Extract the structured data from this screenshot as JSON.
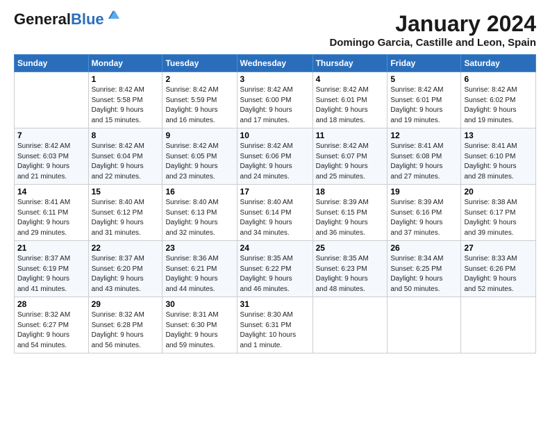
{
  "logo": {
    "general": "General",
    "blue": "Blue"
  },
  "title": "January 2024",
  "subtitle": "Domingo Garcia, Castille and Leon, Spain",
  "headers": [
    "Sunday",
    "Monday",
    "Tuesday",
    "Wednesday",
    "Thursday",
    "Friday",
    "Saturday"
  ],
  "weeks": [
    [
      {
        "day": "",
        "info": ""
      },
      {
        "day": "1",
        "info": "Sunrise: 8:42 AM\nSunset: 5:58 PM\nDaylight: 9 hours\nand 15 minutes."
      },
      {
        "day": "2",
        "info": "Sunrise: 8:42 AM\nSunset: 5:59 PM\nDaylight: 9 hours\nand 16 minutes."
      },
      {
        "day": "3",
        "info": "Sunrise: 8:42 AM\nSunset: 6:00 PM\nDaylight: 9 hours\nand 17 minutes."
      },
      {
        "day": "4",
        "info": "Sunrise: 8:42 AM\nSunset: 6:01 PM\nDaylight: 9 hours\nand 18 minutes."
      },
      {
        "day": "5",
        "info": "Sunrise: 8:42 AM\nSunset: 6:01 PM\nDaylight: 9 hours\nand 19 minutes."
      },
      {
        "day": "6",
        "info": "Sunrise: 8:42 AM\nSunset: 6:02 PM\nDaylight: 9 hours\nand 19 minutes."
      }
    ],
    [
      {
        "day": "7",
        "info": "Sunrise: 8:42 AM\nSunset: 6:03 PM\nDaylight: 9 hours\nand 21 minutes."
      },
      {
        "day": "8",
        "info": "Sunrise: 8:42 AM\nSunset: 6:04 PM\nDaylight: 9 hours\nand 22 minutes."
      },
      {
        "day": "9",
        "info": "Sunrise: 8:42 AM\nSunset: 6:05 PM\nDaylight: 9 hours\nand 23 minutes."
      },
      {
        "day": "10",
        "info": "Sunrise: 8:42 AM\nSunset: 6:06 PM\nDaylight: 9 hours\nand 24 minutes."
      },
      {
        "day": "11",
        "info": "Sunrise: 8:42 AM\nSunset: 6:07 PM\nDaylight: 9 hours\nand 25 minutes."
      },
      {
        "day": "12",
        "info": "Sunrise: 8:41 AM\nSunset: 6:08 PM\nDaylight: 9 hours\nand 27 minutes."
      },
      {
        "day": "13",
        "info": "Sunrise: 8:41 AM\nSunset: 6:10 PM\nDaylight: 9 hours\nand 28 minutes."
      }
    ],
    [
      {
        "day": "14",
        "info": "Sunrise: 8:41 AM\nSunset: 6:11 PM\nDaylight: 9 hours\nand 29 minutes."
      },
      {
        "day": "15",
        "info": "Sunrise: 8:40 AM\nSunset: 6:12 PM\nDaylight: 9 hours\nand 31 minutes."
      },
      {
        "day": "16",
        "info": "Sunrise: 8:40 AM\nSunset: 6:13 PM\nDaylight: 9 hours\nand 32 minutes."
      },
      {
        "day": "17",
        "info": "Sunrise: 8:40 AM\nSunset: 6:14 PM\nDaylight: 9 hours\nand 34 minutes."
      },
      {
        "day": "18",
        "info": "Sunrise: 8:39 AM\nSunset: 6:15 PM\nDaylight: 9 hours\nand 36 minutes."
      },
      {
        "day": "19",
        "info": "Sunrise: 8:39 AM\nSunset: 6:16 PM\nDaylight: 9 hours\nand 37 minutes."
      },
      {
        "day": "20",
        "info": "Sunrise: 8:38 AM\nSunset: 6:17 PM\nDaylight: 9 hours\nand 39 minutes."
      }
    ],
    [
      {
        "day": "21",
        "info": "Sunrise: 8:37 AM\nSunset: 6:19 PM\nDaylight: 9 hours\nand 41 minutes."
      },
      {
        "day": "22",
        "info": "Sunrise: 8:37 AM\nSunset: 6:20 PM\nDaylight: 9 hours\nand 43 minutes."
      },
      {
        "day": "23",
        "info": "Sunrise: 8:36 AM\nSunset: 6:21 PM\nDaylight: 9 hours\nand 44 minutes."
      },
      {
        "day": "24",
        "info": "Sunrise: 8:35 AM\nSunset: 6:22 PM\nDaylight: 9 hours\nand 46 minutes."
      },
      {
        "day": "25",
        "info": "Sunrise: 8:35 AM\nSunset: 6:23 PM\nDaylight: 9 hours\nand 48 minutes."
      },
      {
        "day": "26",
        "info": "Sunrise: 8:34 AM\nSunset: 6:25 PM\nDaylight: 9 hours\nand 50 minutes."
      },
      {
        "day": "27",
        "info": "Sunrise: 8:33 AM\nSunset: 6:26 PM\nDaylight: 9 hours\nand 52 minutes."
      }
    ],
    [
      {
        "day": "28",
        "info": "Sunrise: 8:32 AM\nSunset: 6:27 PM\nDaylight: 9 hours\nand 54 minutes."
      },
      {
        "day": "29",
        "info": "Sunrise: 8:32 AM\nSunset: 6:28 PM\nDaylight: 9 hours\nand 56 minutes."
      },
      {
        "day": "30",
        "info": "Sunrise: 8:31 AM\nSunset: 6:30 PM\nDaylight: 9 hours\nand 59 minutes."
      },
      {
        "day": "31",
        "info": "Sunrise: 8:30 AM\nSunset: 6:31 PM\nDaylight: 10 hours\nand 1 minute."
      },
      {
        "day": "",
        "info": ""
      },
      {
        "day": "",
        "info": ""
      },
      {
        "day": "",
        "info": ""
      }
    ]
  ]
}
